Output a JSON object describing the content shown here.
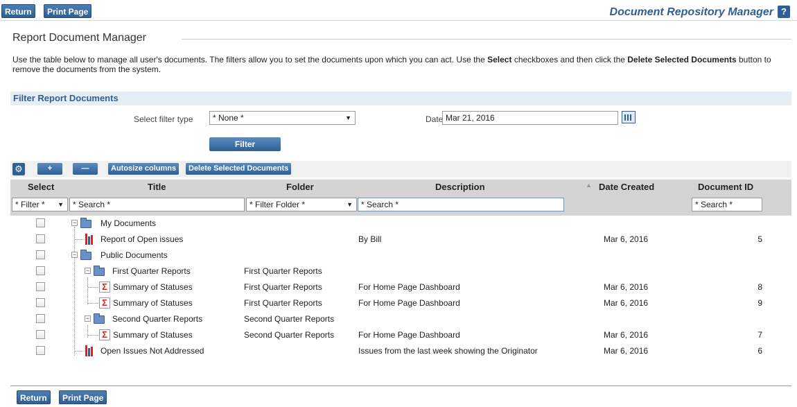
{
  "topbar": {
    "return_label": "Return",
    "print_label": "Print Page",
    "app_title": "Document Repository Manager",
    "help_label": "?"
  },
  "section": {
    "title": "Report Document Manager",
    "intro_1": "Use the table below to manage all user's documents. The filters allow you to set the documents upon which you can act. Use the ",
    "intro_select": "Select",
    "intro_2": " checkboxes and then click the ",
    "intro_delete": "Delete Selected Documents",
    "intro_3": " button to remove the documents from the system."
  },
  "filters": {
    "header": "Filter Report Documents",
    "type_label": "Select filter type",
    "type_value": "* None *",
    "date_label": "Date",
    "date_value": "Mar 21, 2016",
    "filter_button": "Filter"
  },
  "toolbar": {
    "gear_icon": "gear-icon",
    "add_label": "+",
    "remove_label": "—",
    "autosize_label": "Autosize columns",
    "delete_label": "Delete Selected Documents"
  },
  "table": {
    "headers": {
      "select": "Select",
      "title": "Title",
      "folder": "Folder",
      "description": "Description",
      "date": "Date Created",
      "id": "Document ID"
    },
    "filters": {
      "select": "* Filter *",
      "title": "* Search *",
      "folder": "* Filter Folder *",
      "description": "* Search *",
      "id": "* Search *"
    },
    "rows": [
      {
        "title": "My Documents",
        "folder": "",
        "description": "",
        "date": "",
        "id": "",
        "icon": "folder-icon"
      },
      {
        "title": "Report of Open issues",
        "folder": "",
        "description": "By Bill",
        "date": "Mar 6, 2016",
        "id": "5",
        "icon": "report-icon"
      },
      {
        "title": "Public Documents",
        "folder": "",
        "description": "",
        "date": "",
        "id": "",
        "icon": "folder-icon"
      },
      {
        "title": "First Quarter Reports",
        "folder": "First Quarter Reports",
        "description": "",
        "date": "",
        "id": "",
        "icon": "folder-icon"
      },
      {
        "title": "Summary of Statuses",
        "folder": "First Quarter Reports",
        "description": "For Home Page Dashboard",
        "date": "Mar 6, 2016",
        "id": "8",
        "icon": "sigma-icon"
      },
      {
        "title": "Summary of Statuses",
        "folder": "First Quarter Reports",
        "description": "For Home Page Dashboard",
        "date": "Mar 6, 2016",
        "id": "9",
        "icon": "sigma-icon"
      },
      {
        "title": "Second Quarter Reports",
        "folder": "Second Quarter Reports",
        "description": "",
        "date": "",
        "id": "",
        "icon": "folder-icon"
      },
      {
        "title": "Summary of Statuses",
        "folder": "Second Quarter Reports",
        "description": "For Home Page Dashboard",
        "date": "Mar 6, 2016",
        "id": "7",
        "icon": "sigma-icon"
      },
      {
        "title": "Open Issues Not Addressed",
        "folder": "",
        "description": "Issues from the last week showing the Originator",
        "date": "Mar 6, 2016",
        "id": "6",
        "icon": "report-icon"
      }
    ]
  },
  "footer": {
    "return_label": "Return",
    "print_label": "Print Page"
  }
}
